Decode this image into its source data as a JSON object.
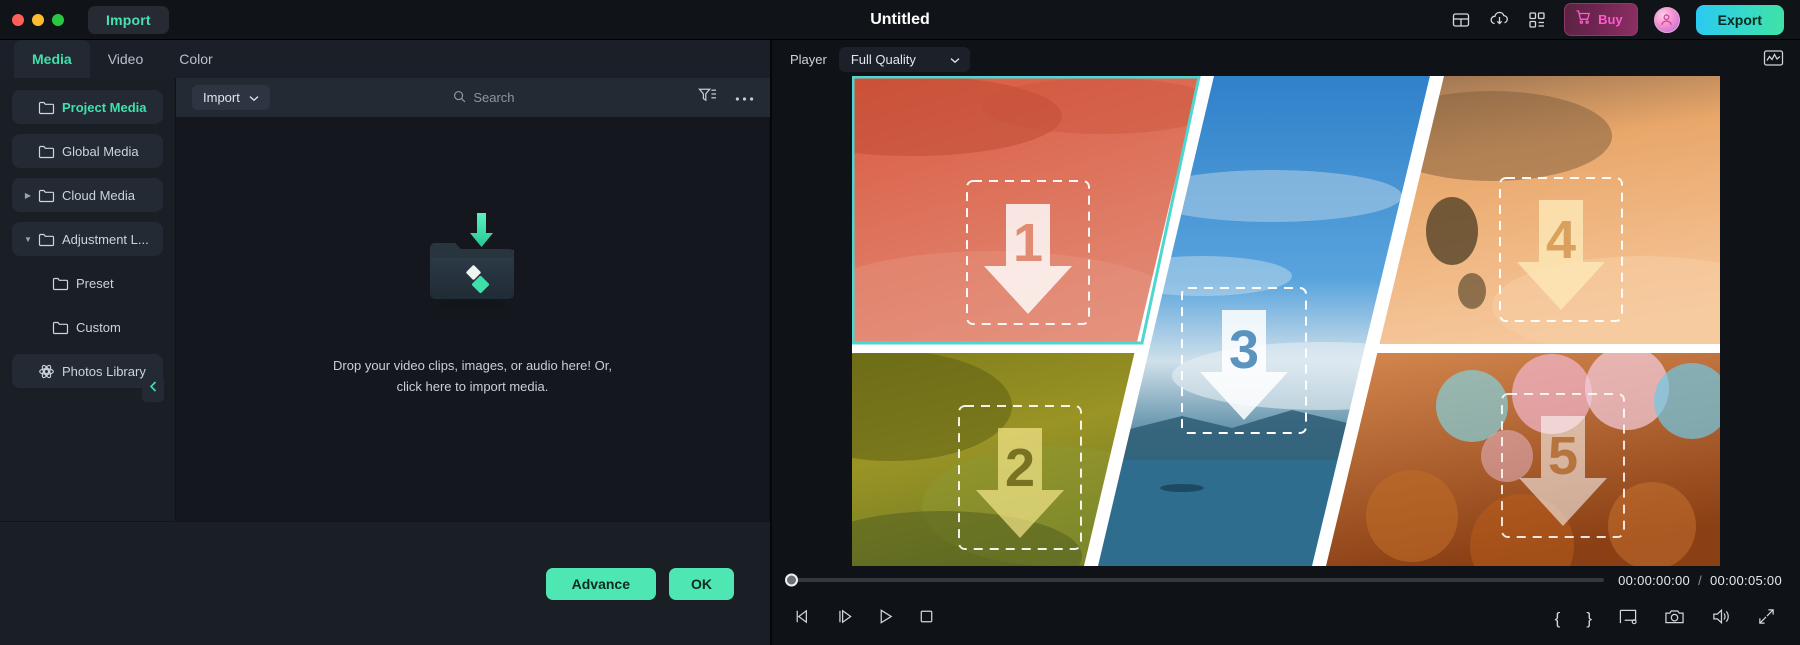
{
  "titlebar": {
    "import_label": "Import",
    "project_title": "Untitled",
    "buy_label": "Buy",
    "export_label": "Export",
    "icons": [
      "monitor-icon",
      "cloud-download-icon",
      "grid-apps-icon",
      "cart-icon",
      "avatar-icon"
    ]
  },
  "tabs": [
    {
      "label": "Media",
      "active": true
    },
    {
      "label": "Video",
      "active": false
    },
    {
      "label": "Color",
      "active": false
    }
  ],
  "sidebar": {
    "items": [
      {
        "label": "Project Media",
        "icon": "folder-icon",
        "active": true,
        "caret": "",
        "child": false,
        "highlight": true
      },
      {
        "label": "Global Media",
        "icon": "folder-icon",
        "active": false,
        "caret": "",
        "child": false,
        "highlight": true
      },
      {
        "label": "Cloud Media",
        "icon": "folder-icon",
        "active": false,
        "caret": "collapsed",
        "child": false,
        "highlight": true
      },
      {
        "label": "Adjustment L...",
        "icon": "folder-icon",
        "active": false,
        "caret": "expanded",
        "child": false,
        "highlight": true
      },
      {
        "label": "Preset",
        "icon": "folder-icon",
        "active": false,
        "caret": "",
        "child": true,
        "highlight": false
      },
      {
        "label": "Custom",
        "icon": "folder-icon",
        "active": false,
        "caret": "",
        "child": true,
        "highlight": false
      },
      {
        "label": "Photos Library",
        "icon": "photos-library-icon",
        "active": false,
        "caret": "",
        "child": false,
        "highlight": true
      }
    ],
    "collapse_icon": "chevron-left-icon"
  },
  "media_toolbar": {
    "import_label": "Import",
    "import_caret": "chevron-down-icon",
    "search_placeholder": "Search",
    "search_value": "",
    "filter_icon": "filter-sort-icon",
    "more_icon": "more-horizontal-icon"
  },
  "dropzone": {
    "line1": "Drop your video clips, images, or audio here! Or,",
    "line2": "click here to import media.",
    "art_icon": "folder-import-icon"
  },
  "left_footer": {
    "advance_label": "Advance",
    "ok_label": "OK"
  },
  "player": {
    "label": "Player",
    "quality_value": "Full Quality",
    "quality_caret": "chevron-down-icon",
    "scope_icon": "waveform-scope-icon",
    "current_time": "00:00:00:00",
    "separator": "/",
    "total_time": "00:00:05:00",
    "progress_percent": 0,
    "transport": [
      {
        "name": "prev-frame-button",
        "glyph": "prev-frame-icon"
      },
      {
        "name": "next-frame-button",
        "glyph": "next-frame-icon"
      },
      {
        "name": "play-button",
        "glyph": "play-icon"
      },
      {
        "name": "stop-button",
        "glyph": "stop-icon"
      }
    ],
    "right_tools": [
      {
        "name": "mark-in-button",
        "glyph": "{"
      },
      {
        "name": "mark-out-button",
        "glyph": "}"
      },
      {
        "name": "display-settings-button",
        "glyph": "monitor-settings-icon"
      },
      {
        "name": "snapshot-button",
        "glyph": "camera-icon"
      },
      {
        "name": "volume-button",
        "glyph": "speaker-icon"
      },
      {
        "name": "fullscreen-button",
        "glyph": "expand-icon"
      }
    ]
  },
  "preview": {
    "template_name": "split-screen-5-up",
    "slots": [
      {
        "number": "1",
        "tint": "#e0614a"
      },
      {
        "number": "2",
        "tint": "#a09520"
      },
      {
        "number": "3",
        "tint": "#3b8fd4"
      },
      {
        "number": "4",
        "tint": "#f0a766"
      },
      {
        "number": "5",
        "tint": "#c4672a"
      }
    ]
  },
  "colors": {
    "accent": "#3fe0ad",
    "export_gradient_start": "#2bc9f2",
    "export_gradient_end": "#3fe3a5",
    "buy_text": "#ff5bd0",
    "panel_bg": "#1a1f26",
    "titlebar_bg": "#101318"
  }
}
